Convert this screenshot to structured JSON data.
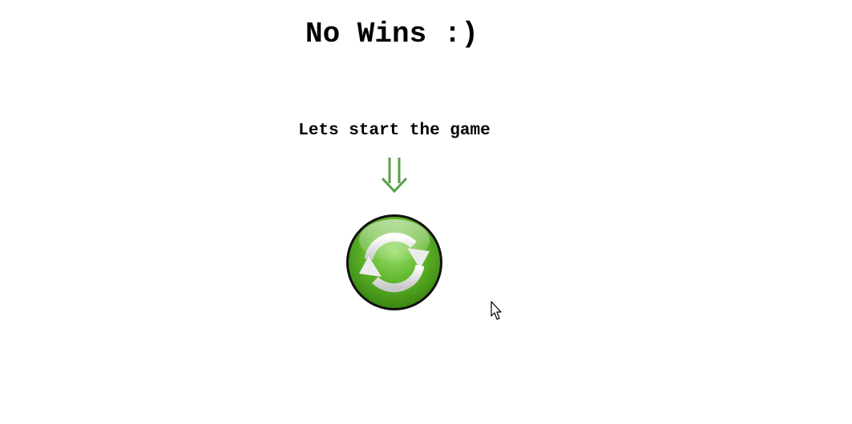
{
  "status": {
    "title": "No Wins :)"
  },
  "start": {
    "prompt": "Lets start the game"
  },
  "icons": {
    "arrow": "double-down-arrow-icon",
    "restart": "refresh-icon",
    "cursor": "mouse-pointer-icon"
  },
  "colors": {
    "arrow": "#5aa04a",
    "button_light": "#9ee070",
    "button_dark": "#3d8a12",
    "button_ring": "#111111"
  }
}
